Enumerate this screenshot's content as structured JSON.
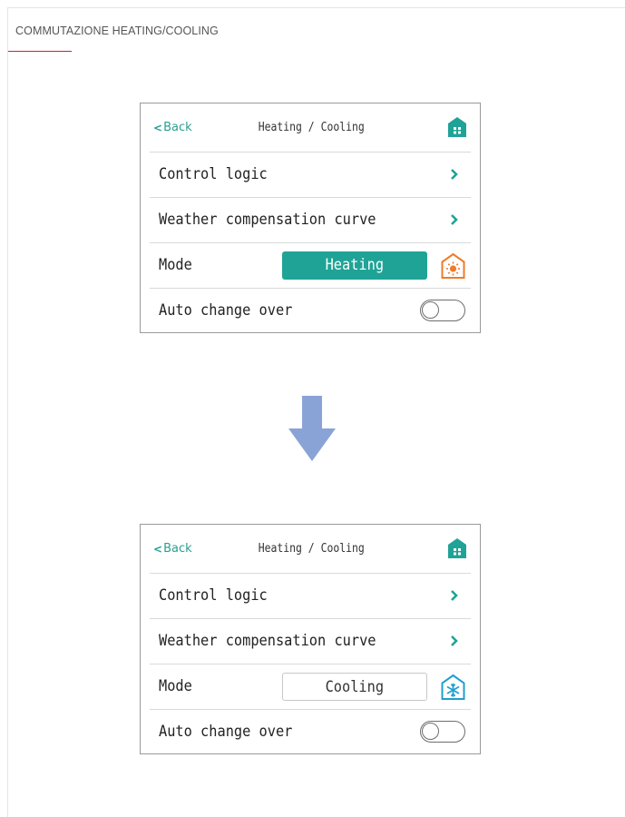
{
  "page": {
    "section_title": "COMMUTAZIONE HEATING/COOLING",
    "accent_color": "#cc2229"
  },
  "screens": [
    {
      "back_label": "Back",
      "title": "Heating / Cooling",
      "rows": {
        "control_logic": "Control logic",
        "weather_curve": "Weather compensation curve",
        "mode_label": "Mode",
        "mode_value": "Heating",
        "auto_change_label": "Auto change over"
      },
      "auto_change_on": false,
      "mode_icon": "house-sun-icon",
      "colors": {
        "mode_active": "#1fa396",
        "icon": "#f07a2a"
      }
    },
    {
      "back_label": "Back",
      "title": "Heating / Cooling",
      "rows": {
        "control_logic": "Control logic",
        "weather_curve": "Weather compensation curve",
        "mode_label": "Mode",
        "mode_value": "Cooling",
        "auto_change_label": "Auto change over"
      },
      "auto_change_on": false,
      "mode_icon": "house-snowflake-icon",
      "colors": {
        "mode_active": "#ffffff",
        "icon": "#1f9fd0"
      }
    }
  ],
  "transition_icon": "arrow-down-icon",
  "transition_color": "#8aa3d6"
}
